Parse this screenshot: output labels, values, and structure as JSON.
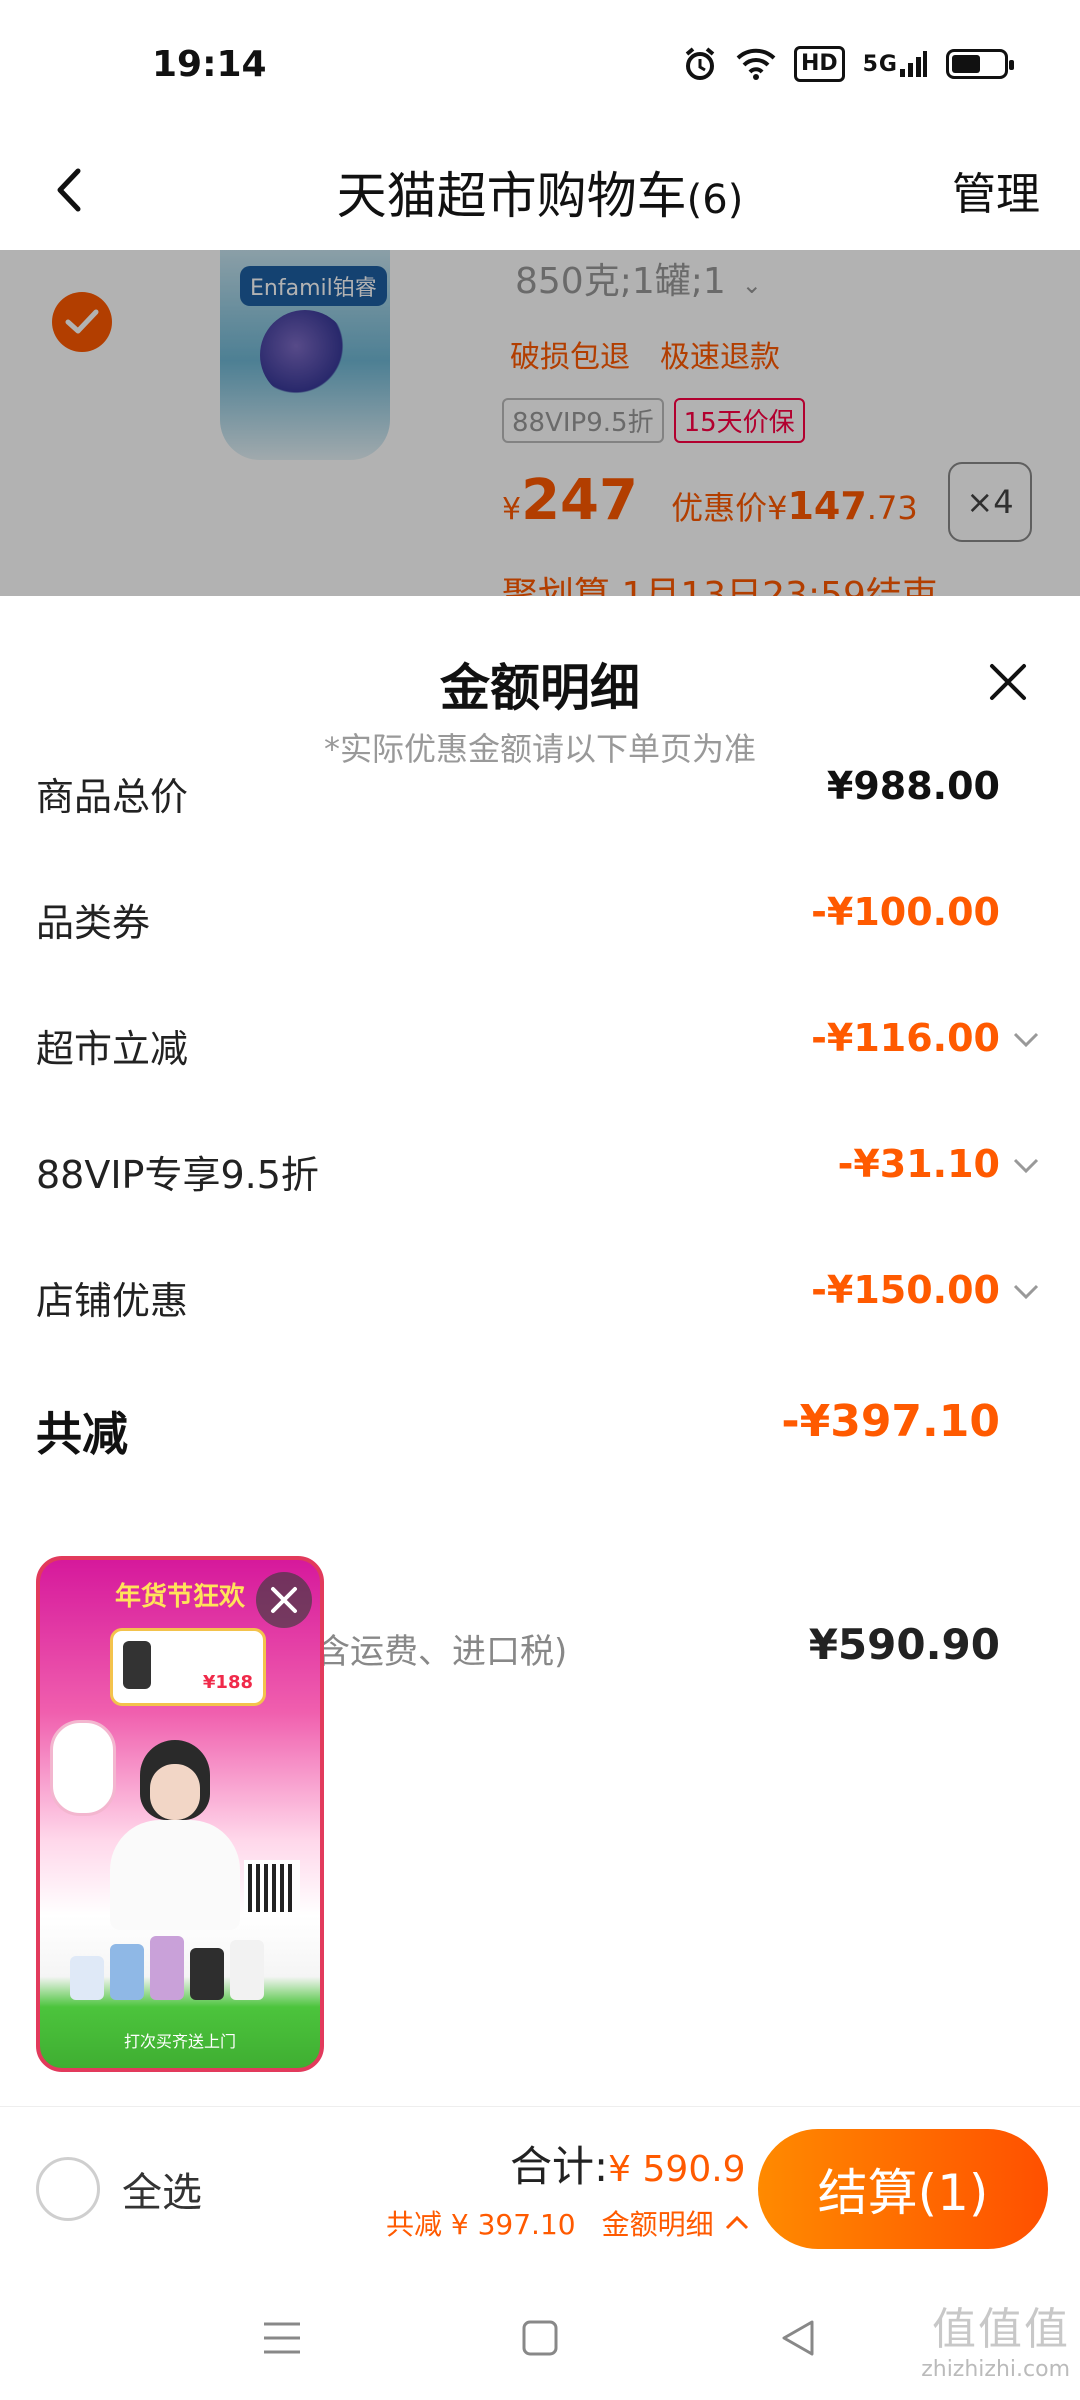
{
  "status_bar": {
    "time": "19:14",
    "icons": [
      "alarm-icon",
      "wifi-icon",
      "hd-icon",
      "5g-signal-icon",
      "battery-icon"
    ],
    "hd_label": "HD",
    "network_label": "5G",
    "battery_level": 0.55
  },
  "header": {
    "title": "天猫超市购物车",
    "count": "(6)",
    "manage_label": "管理"
  },
  "cart_item": {
    "brand": "Enfamil铂睿",
    "spec": "850克;1罐;1",
    "services": [
      "破损包退",
      "极速退款"
    ],
    "badges": [
      "88VIP9.5折",
      "15天价保"
    ],
    "price_symbol": "¥",
    "price": "247",
    "discount_label": "优惠价",
    "discount_symbol": "¥",
    "discount_price_int": "147",
    "discount_price_dec": ".73",
    "quantity": "×4",
    "promo": "聚划算 1月13日23:59结束"
  },
  "sheet": {
    "title": "金额明细",
    "subtitle": "*实际优惠金额请以下单页为准",
    "rows": [
      {
        "label": "商品总价",
        "value": "¥988.00"
      },
      {
        "label": "品类券",
        "value": "-¥100.00"
      },
      {
        "label": "超市立减",
        "value": "-¥116.00"
      },
      {
        "label": "88VIP专享9.5折",
        "value": "-¥31.10"
      },
      {
        "label": "店铺优惠",
        "value": "-¥150.00"
      }
    ],
    "total_label": "共减",
    "total_value": "-¥397.10",
    "final_note": "含运费、进口税)",
    "final_value": "¥590.90"
  },
  "ad": {
    "title": "年货节狂欢",
    "card_price": "¥188",
    "footer": "打次买齐送上门"
  },
  "bottom_bar": {
    "select_all_label": "全选",
    "total_prefix": "合计:",
    "total_amount": "¥ 590.9",
    "saved_text": "共减 ¥ 397.10",
    "detail_link": "金额明细",
    "checkout_label": "结算(1)"
  },
  "watermark": {
    "line1": "值值值",
    "line2": "zhizhizhi.com"
  },
  "colors": {
    "accent": "#ff5a00",
    "checkout_start": "#ff8a00",
    "checkout_end": "#ff5000",
    "badge_red": "#ff0044"
  }
}
